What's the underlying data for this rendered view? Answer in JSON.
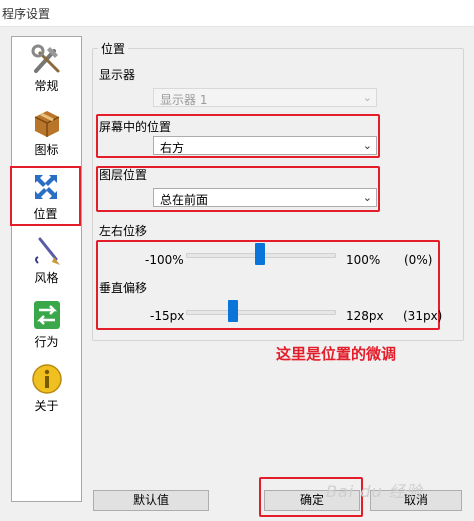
{
  "window": {
    "title": "程序设置"
  },
  "nav": {
    "items": [
      {
        "label": "常规",
        "icon": "tools-icon"
      },
      {
        "label": "图标",
        "icon": "box-icon"
      },
      {
        "label": "位置",
        "icon": "move-arrows-icon",
        "selected": true
      },
      {
        "label": "风格",
        "icon": "brush-icon"
      },
      {
        "label": "行为",
        "icon": "swap-arrows-icon"
      },
      {
        "label": "关于",
        "icon": "info-icon"
      }
    ]
  },
  "position": {
    "group_title": "位置",
    "monitor_label": "显示器",
    "monitor_value": "显示器 1",
    "screen_pos_label": "屏幕中的位置",
    "screen_pos_value": "右方",
    "layer_label": "图层位置",
    "layer_value": "总在前面",
    "h_offset": {
      "label": "左右位移",
      "min": "-100%",
      "max": "100%",
      "current": "(0%)",
      "fraction": 0.5
    },
    "v_offset": {
      "label": "垂直偏移",
      "min": "-15px",
      "max": "128px",
      "current": "(31px)",
      "fraction": 0.32
    }
  },
  "annotation": "这里是位置的微调",
  "buttons": {
    "default": "默认值",
    "ok": "确定",
    "cancel": "取消"
  },
  "watermark": "Bai du 经验",
  "colors": {
    "accent": "#0a74d8",
    "highlight": "#e31d2a"
  }
}
